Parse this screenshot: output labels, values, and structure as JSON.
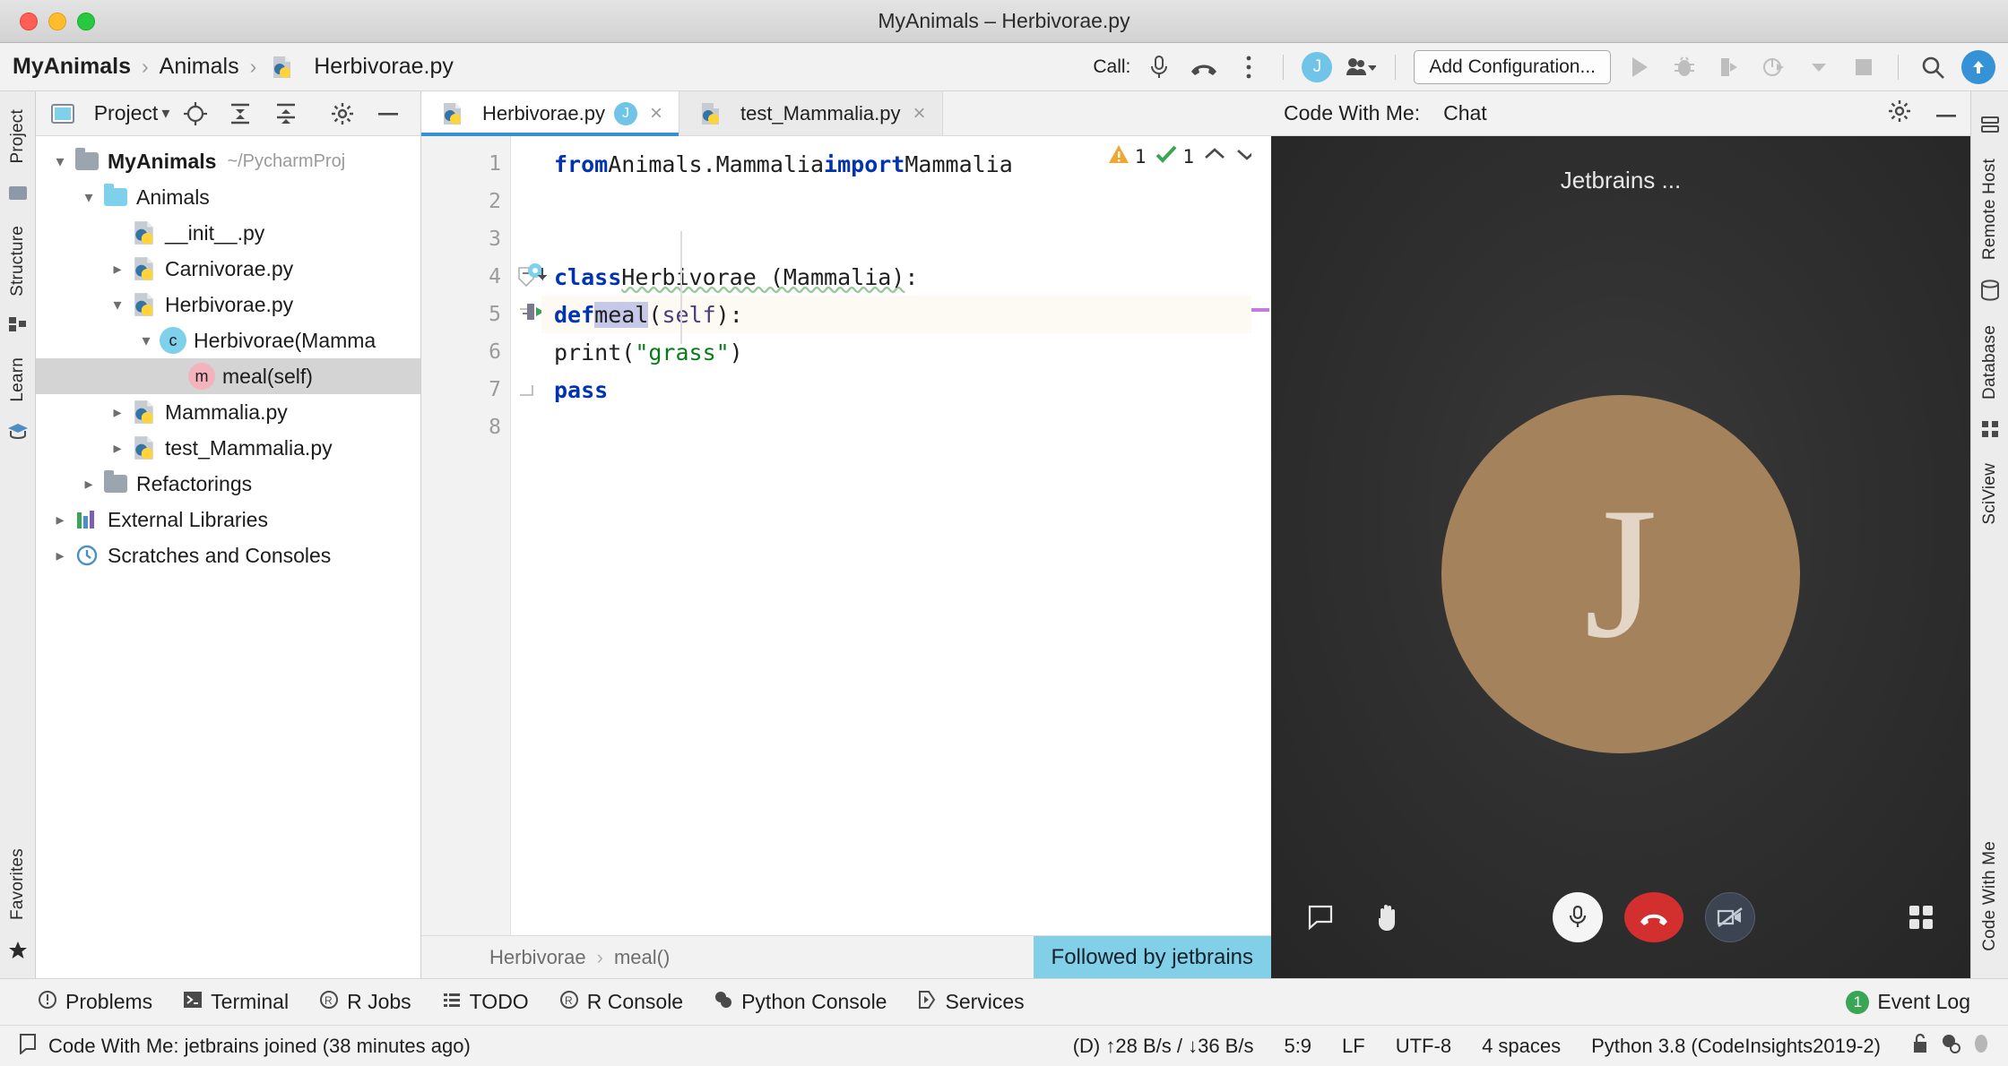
{
  "window": {
    "title": "MyAnimals – Herbivorae.py",
    "traffic_lights": [
      "close",
      "minimize",
      "zoom"
    ]
  },
  "toolbar": {
    "breadcrumbs": [
      {
        "label": "MyAnimals",
        "icon": null
      },
      {
        "label": "Animals",
        "icon": null
      },
      {
        "label": "Herbivorae.py",
        "icon": "python-file-icon"
      }
    ],
    "separator": "›",
    "call_label": "Call:",
    "call_icons": [
      "microphone-icon",
      "hang-up-icon",
      "more-options-icon"
    ],
    "avatar_initial": "J",
    "people_icon": "people-dropdown-icon",
    "add_configuration": "Add Configuration...",
    "run_icons": [
      "run-icon",
      "debug-icon",
      "run-coverage-icon",
      "profile-icon",
      "profile-dropdown-icon",
      "stop-icon"
    ],
    "search_icon": "search-icon",
    "update_icon": "update-project-icon"
  },
  "left_rail": {
    "items": [
      {
        "label": "Project",
        "icon": "project-icon"
      },
      {
        "label": "Structure",
        "icon": "structure-icon"
      },
      {
        "label": "Learn",
        "icon": "learn-icon"
      },
      {
        "label": "Favorites",
        "icon": "favorites-star-icon"
      }
    ]
  },
  "right_rail": {
    "items": [
      {
        "label": "Remote Host",
        "icon": "remote-host-icon"
      },
      {
        "label": "Database",
        "icon": "database-icon"
      },
      {
        "label": "SciView",
        "icon": "sciview-icon"
      },
      {
        "label": "Code With Me",
        "icon": "code-with-me-icon"
      }
    ]
  },
  "project_panel": {
    "title": "Project",
    "title_dropdown": "▾",
    "toolbar_icons": [
      "locate-icon",
      "expand-all-icon",
      "collapse-all-icon",
      "settings-gear-icon",
      "hide-icon"
    ],
    "tree": [
      {
        "label": "MyAnimals",
        "suffix": "~/PycharmProj",
        "indent": 0,
        "arrow": "down",
        "icon": "folder-gray-icon",
        "bold": true,
        "selected": false
      },
      {
        "label": "Animals",
        "suffix": "",
        "indent": 1,
        "arrow": "down",
        "icon": "folder-blue-icon",
        "bold": false,
        "selected": false
      },
      {
        "label": "__init__.py",
        "suffix": "",
        "indent": 2,
        "arrow": "none",
        "icon": "python-file-icon",
        "bold": false,
        "selected": false
      },
      {
        "label": "Carnivorae.py",
        "suffix": "",
        "indent": 2,
        "arrow": "right",
        "icon": "python-file-icon",
        "bold": false,
        "selected": false
      },
      {
        "label": "Herbivorae.py",
        "suffix": "",
        "indent": 2,
        "arrow": "down",
        "icon": "python-file-icon",
        "bold": false,
        "selected": false
      },
      {
        "label": "Herbivorae(Mamma",
        "suffix": "",
        "indent": 3,
        "arrow": "down",
        "icon": "class-icon",
        "bold": false,
        "selected": false
      },
      {
        "label": "meal(self)",
        "suffix": "",
        "indent": 4,
        "arrow": "none",
        "icon": "method-icon",
        "bold": false,
        "selected": true
      },
      {
        "label": "Mammalia.py",
        "suffix": "",
        "indent": 2,
        "arrow": "right",
        "icon": "python-file-icon",
        "bold": false,
        "selected": false
      },
      {
        "label": "test_Mammalia.py",
        "suffix": "",
        "indent": 2,
        "arrow": "right",
        "icon": "python-file-icon",
        "bold": false,
        "selected": false
      },
      {
        "label": "Refactorings",
        "suffix": "",
        "indent": 1,
        "arrow": "right",
        "icon": "folder-gray-icon",
        "bold": false,
        "selected": false
      },
      {
        "label": "External Libraries",
        "suffix": "",
        "indent": 0,
        "arrow": "right",
        "icon": "external-libraries-icon",
        "bold": false,
        "selected": false
      },
      {
        "label": "Scratches and Consoles",
        "suffix": "",
        "indent": 0,
        "arrow": "right",
        "icon": "scratches-icon",
        "bold": false,
        "selected": false
      }
    ]
  },
  "editor": {
    "tabs": [
      {
        "label": "Herbivorae.py",
        "icon": "python-file-icon",
        "badge": "J",
        "active": true,
        "close": "×"
      },
      {
        "label": "test_Mammalia.py",
        "icon": "python-file-icon",
        "badge": null,
        "active": false,
        "close": "×"
      }
    ],
    "lines": [
      {
        "n": "1",
        "text": "from Animals.Mammalia import Mammalia"
      },
      {
        "n": "2",
        "text": ""
      },
      {
        "n": "3",
        "text": ""
      },
      {
        "n": "4",
        "text": "class Herbivorae (Mammalia):"
      },
      {
        "n": "5",
        "text": "    def meal(self):"
      },
      {
        "n": "6",
        "text": "        print(\"grass\")"
      },
      {
        "n": "7",
        "text": "        pass"
      },
      {
        "n": "8",
        "text": ""
      }
    ],
    "inspections": {
      "warning_count": "1",
      "ok_count": "1",
      "warning_icon": "warning-triangle-icon",
      "ok_icon": "inspection-ok-icon",
      "prev_icon": "previous-highlight-icon",
      "next_icon": "next-highlight-icon"
    },
    "gutter_marks": [
      {
        "line": "4",
        "icon": "class-override-marker"
      },
      {
        "line": "5",
        "icon": "method-run-marker"
      }
    ],
    "breadcrumb": {
      "parts": [
        "Herbivorae",
        "meal()"
      ],
      "separator": "›"
    },
    "followed_banner": "Followed by jetbrains"
  },
  "code_with_me": {
    "header_title": "Code With Me:",
    "tab_label": "Chat",
    "settings_icon": "settings-gear-icon",
    "hide_icon": "hide-icon",
    "participant_name": "Jetbrains ...",
    "avatar_initial": "J",
    "avatar_color": "#a3825c",
    "controls": [
      {
        "name": "chat-icon",
        "style": "plain"
      },
      {
        "name": "raise-hand-icon",
        "style": "plain"
      },
      {
        "name": "microphone-icon",
        "style": "mic"
      },
      {
        "name": "hang-up-icon",
        "style": "hang"
      },
      {
        "name": "camera-off-icon",
        "style": "cam"
      },
      {
        "name": "grid-layout-icon",
        "style": "plain"
      }
    ]
  },
  "tool_windows": {
    "items": [
      {
        "label": "Problems",
        "icon": "problems-icon"
      },
      {
        "label": "Terminal",
        "icon": "terminal-icon"
      },
      {
        "label": "R Jobs",
        "icon": "r-jobs-icon"
      },
      {
        "label": "TODO",
        "icon": "todo-icon"
      },
      {
        "label": "R Console",
        "icon": "r-console-icon"
      },
      {
        "label": "Python Console",
        "icon": "python-console-icon"
      },
      {
        "label": "Services",
        "icon": "services-icon"
      }
    ],
    "event_log": {
      "label": "Event Log",
      "count": "1"
    }
  },
  "status_bar": {
    "message_icon": "message-balloon-icon",
    "message": "Code With Me: jetbrains joined (38 minutes ago)",
    "segments": [
      "(D) ↑28 B/s / ↓36 B/s",
      "5:9",
      "LF",
      "UTF-8",
      "4 spaces",
      "Python 3.8 (CodeInsights2019-2)"
    ],
    "right_icons": [
      "unlock-icon",
      "inspection-settings-icon",
      "notifications-icon"
    ]
  }
}
